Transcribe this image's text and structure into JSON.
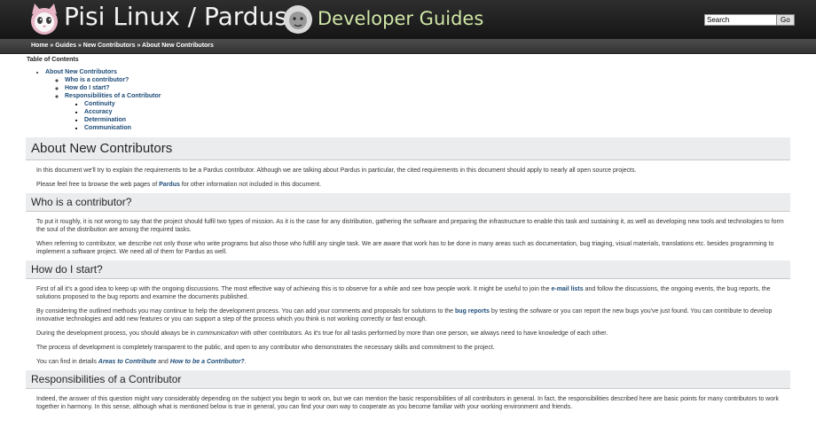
{
  "header": {
    "site_title": "Pisi Linux / Pardus",
    "subtitle": "Developer Guides",
    "search_value": "Search",
    "search_button": "Go"
  },
  "breadcrumb": {
    "home": "Home",
    "guides": "Guides",
    "new_contributors": "New Contributors",
    "current": "About New Contributors",
    "separator": " » "
  },
  "toc": {
    "title": "Table of Contents",
    "items": [
      "About New Contributors",
      "Who is a contributor?",
      "How do I start?",
      "Responsibilities of a Contributor",
      "Continuity",
      "Accuracy",
      "Determination",
      "Communication"
    ]
  },
  "sections": {
    "about": {
      "heading": "About New Contributors",
      "p1": "In this document we'll try to explain the requirements to be a Pardus contributor. Although we are talking about Pardus in particular, the cited requirements in this document should apply to nearly all open source projects.",
      "p2_before": "Please feel free to browse the web pages of ",
      "p2_link": "Pardus",
      "p2_after": " for other information not included in this document."
    },
    "who": {
      "heading": "Who is a contributor?",
      "p1": "To put it roughly, it is not wrong to say that the project should fulfil two types of mission. As it is the case for any distribution, gathering the software and preparing the infrastructure to enable this task and sustaining it, as well as developing new tools and technologies to form the soul of the distribution are among the required tasks.",
      "p2": "When referring to contributor, we describe not only those who write programs but also those who fulfill any single task. We are aware that work has to be done in many areas such as documentation, bug triaging, visual materials, translations etc. besides programming to implement a software project. We need all of them for Pardus as well."
    },
    "start": {
      "heading": "How do I start?",
      "p1_before": "First of all it's a good idea to keep up with the ongoing discussions. The most effective way of achieving this is to observe for a while and see how people work. It might be useful to join the ",
      "p1_link": "e-mail lists",
      "p1_after": " and follow the discussions, the ongoing events, the bug reports, the solutions proposed to the bug reports and examine the documents published.",
      "p2_before": "By considering the outlined methods you may continue to help the development process. You can add your comments and proposals for solutions to the ",
      "p2_link": "bug reports",
      "p2_after": " by testing the sofware or you can report the new bugs you've just found. You can contribute to develop innovative technologies and add new features or you can support a step of the process which you think is not working correctly or fast enough.",
      "p3_before": "During the development process, you should always be in ",
      "p3_em": "communication",
      "p3_after": " with other contributors. As it's true for all tasks performed by more than one person, we always need to have knowledge of each other.",
      "p4": "The process of development is completely transparent to the public, and open to any contributor who demonstrates the necessary skills and commitment to the project.",
      "p5_before": "You can find in details ",
      "p5_link1": "Areas to Contribute",
      "p5_mid": " and ",
      "p5_link2": "How to be a Contributor?",
      "p5_after": "."
    },
    "resp": {
      "heading": "Responsibilities of a Contributor",
      "p1": "Indeed, the answer of this question might vary considerably depending on the subject you begin to work on, but we can mention the basic responsibilities of all contributors in general. In fact, the responsibilities described here are basic points for many contributors to work together in harmony. In this sense, although what is mentioned below is true in general, you can find your own way to cooperate as you become familiar with your working environment and friends."
    }
  }
}
